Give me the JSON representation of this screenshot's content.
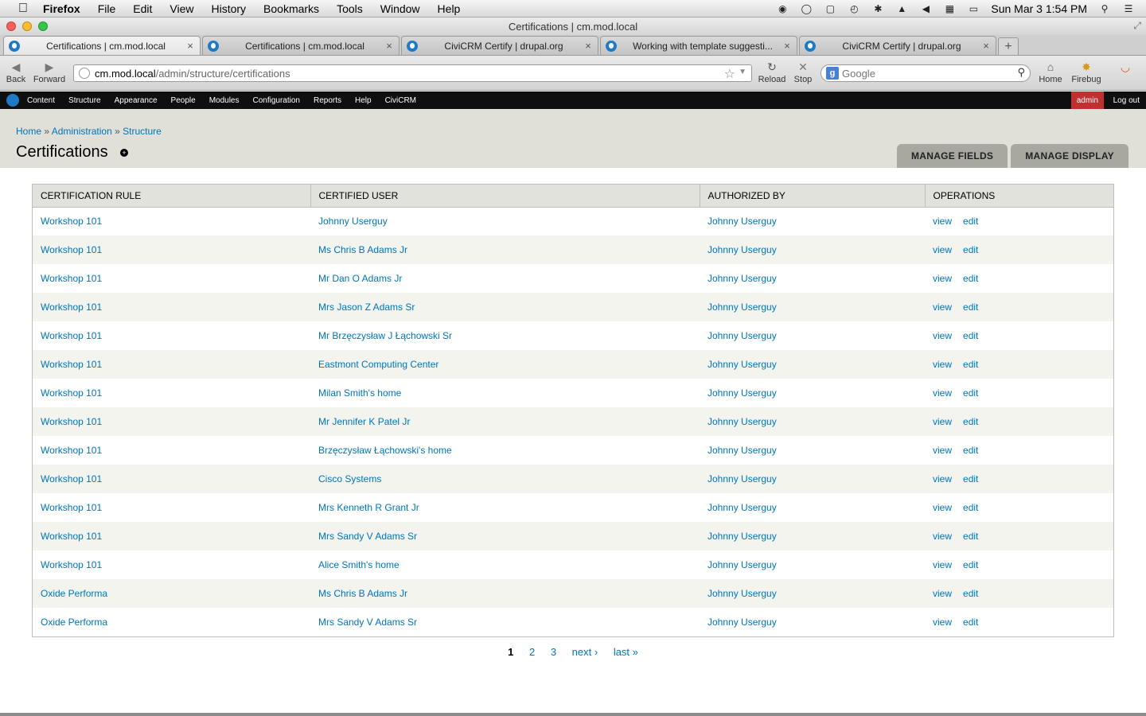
{
  "menubar": {
    "app": "Firefox",
    "items": [
      "File",
      "Edit",
      "View",
      "History",
      "Bookmarks",
      "Tools",
      "Window",
      "Help"
    ],
    "clock": "Sun Mar 3  1:54 PM"
  },
  "window": {
    "title": "Certifications | cm.mod.local"
  },
  "tabs": [
    {
      "label": "Certifications | cm.mod.local",
      "active": true
    },
    {
      "label": "Certifications | cm.mod.local",
      "active": false
    },
    {
      "label": "CiviCRM Certify | drupal.org",
      "active": false
    },
    {
      "label": "Working with template suggesti...",
      "active": false
    },
    {
      "label": "CiviCRM Certify | drupal.org",
      "active": false
    }
  ],
  "nav": {
    "back": "Back",
    "forward": "Forward",
    "url_host": "cm.mod.local",
    "url_path": "/admin/structure/certifications",
    "reload": "Reload",
    "stop": "Stop",
    "search_placeholder": "Google",
    "home": "Home",
    "firebug": "Firebug"
  },
  "toolbar": {
    "links": [
      "Content",
      "Structure",
      "Appearance",
      "People",
      "Modules",
      "Configuration",
      "Reports",
      "Help",
      "CiviCRM"
    ],
    "user": "admin",
    "logout": "Log out"
  },
  "header": {
    "breadcrumb": [
      "Home",
      "Administration",
      "Structure"
    ],
    "separator": "»",
    "title": "Certifications",
    "tabs": [
      "MANAGE FIELDS",
      "MANAGE DISPLAY"
    ]
  },
  "table": {
    "columns": [
      "CERTIFICATION RULE",
      "CERTIFIED USER",
      "AUTHORIZED BY",
      "OPERATIONS"
    ],
    "rows": [
      [
        "Workshop 101",
        "Johnny Userguy",
        "Johnny Userguy"
      ],
      [
        "Workshop 101",
        "Ms Chris B Adams Jr",
        "Johnny Userguy"
      ],
      [
        "Workshop 101",
        "Mr Dan O Adams Jr",
        "Johnny Userguy"
      ],
      [
        "Workshop 101",
        "Mrs Jason Z Adams Sr",
        "Johnny Userguy"
      ],
      [
        "Workshop 101",
        "Mr Brzęczysław J Łąchowski Sr",
        "Johnny Userguy"
      ],
      [
        "Workshop 101",
        "Eastmont Computing Center",
        "Johnny Userguy"
      ],
      [
        "Workshop 101",
        "Milan Smith's home",
        "Johnny Userguy"
      ],
      [
        "Workshop 101",
        "Mr Jennifer K Patel Jr",
        "Johnny Userguy"
      ],
      [
        "Workshop 101",
        "Brzęczysław Łąchowski's home",
        "Johnny Userguy"
      ],
      [
        "Workshop 101",
        "Cisco Systems",
        "Johnny Userguy"
      ],
      [
        "Workshop 101",
        "Mrs Kenneth R Grant Jr",
        "Johnny Userguy"
      ],
      [
        "Workshop 101",
        "Mrs Sandy V Adams Sr",
        "Johnny Userguy"
      ],
      [
        "Workshop 101",
        "Alice Smith's home",
        "Johnny Userguy"
      ],
      [
        "Oxide Performa",
        "Ms Chris B Adams Jr",
        "Johnny Userguy"
      ],
      [
        "Oxide Performa",
        "Mrs Sandy V Adams Sr",
        "Johnny Userguy"
      ]
    ],
    "op_view": "view",
    "op_edit": "edit"
  },
  "pager": {
    "pages": [
      "1",
      "2",
      "3"
    ],
    "current": "1",
    "next": "next ›",
    "last": "last »"
  }
}
